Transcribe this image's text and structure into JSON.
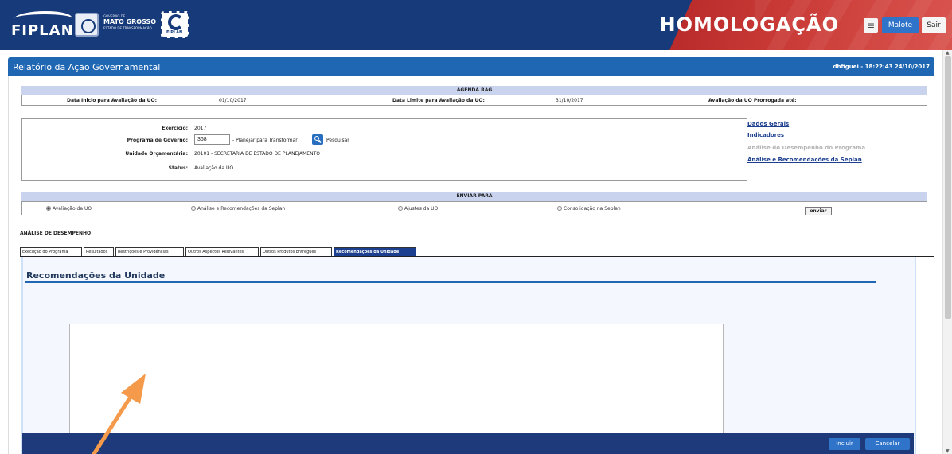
{
  "header": {
    "logo_text": "FIPLAN",
    "gov_small": "GOVERNO DE",
    "gov_big": "MATO GROSSO",
    "gov_tag": "ESTADO DE TRANSFORMAÇÃO",
    "badge_text": "FIPLAN",
    "environment": "HOMOLOGAÇÃO",
    "menu_icon": "≡",
    "malote_label": "Malote",
    "sair_label": "Sair",
    "colors": {
      "primary": "#163a7a",
      "alert": "#c93a36",
      "button": "#2f74c9"
    }
  },
  "window": {
    "title": "Relatório da Ação Governamental",
    "user_meta": "dhfiguei - 18:22:43 24/10/2017"
  },
  "agenda": {
    "heading": "AGENDA RAG",
    "inicio_label": "Data Inicio para Avaliação da UO:",
    "inicio_value": "01/10/2017",
    "limite_label": "Data Limite para Avaliação da UO:",
    "limite_value": "31/10/2017",
    "prorrogada_label": "Avaliação da UO Prorrogada até:"
  },
  "programa": {
    "exercicio_label": "Exercício:",
    "exercicio_value": "2017",
    "programa_label": "Programa de Governo:",
    "programa_value": "368",
    "programa_desc": "- Planejar para Transformar",
    "pesquisar_label": "Pesquisar",
    "unidade_label": "Unidade Orçamentária:",
    "unidade_value": "20101 - SECRETARIA DE ESTADO DE PLANEJAMENTO",
    "status_label": "Status:",
    "status_value": "Avaliação da UO"
  },
  "side_links": [
    {
      "label": "Dados Gerais"
    },
    {
      "label": "Indicadores"
    },
    {
      "label": "Análise do Desempenho do Programa"
    },
    {
      "label": "Análise e Recomendações da Seplan"
    }
  ],
  "enviar": {
    "heading": "ENVIAR PARA",
    "options": [
      "Avaliação da UO",
      "Análise e Recomendações da Seplan",
      "Ajustes da UO",
      "Consolidação na Seplan"
    ],
    "selected": "Avaliação da UO",
    "button_label": "enviar"
  },
  "analise": {
    "title": "ANÁLISE DE DESEMPENHO",
    "tabs": [
      "Execução do Programa",
      "Resultados",
      "Restrições e Providências",
      "Outros Aspectos Relevantes",
      "Outros Produtos Entregues",
      "Recomendações da Unidade"
    ],
    "active_tab": "Recomendações da Unidade",
    "panel_title": "Recomendações da Unidade"
  },
  "footer": {
    "incluir_label": "Incluir",
    "cancelar_label": "Cancelar"
  },
  "annotation": {
    "arrow_color": "#f59a4a"
  }
}
